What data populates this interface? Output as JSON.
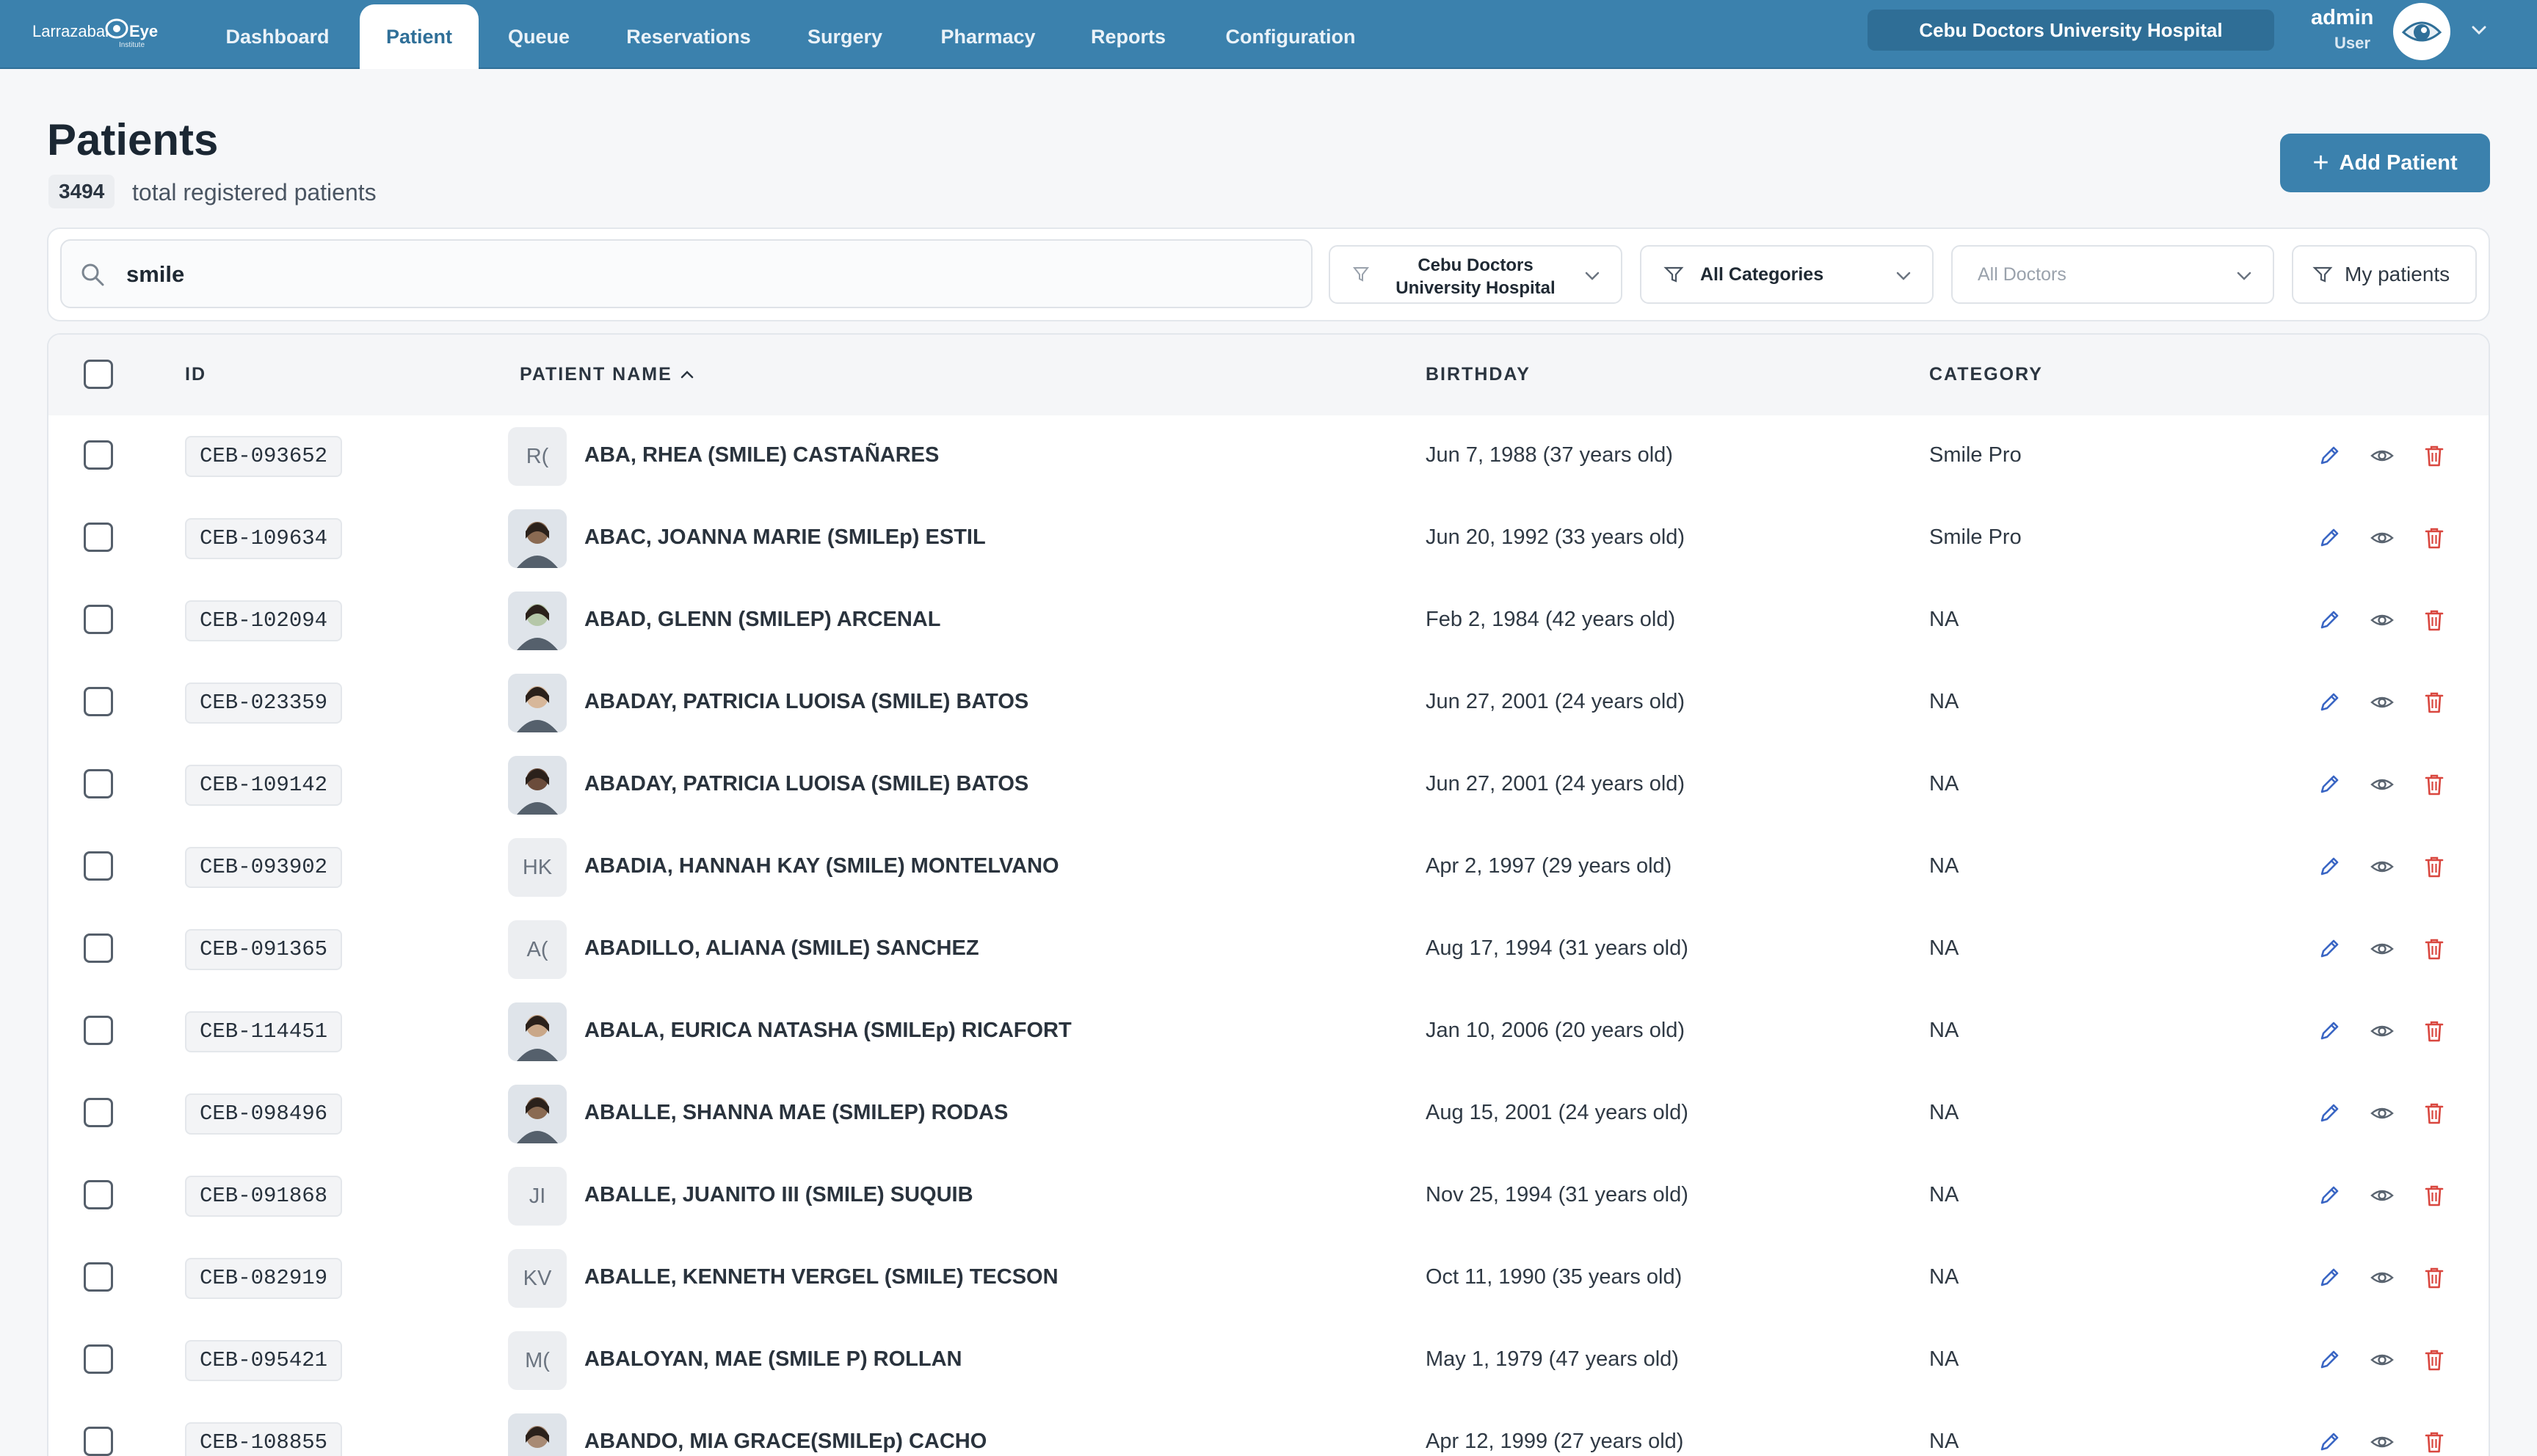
{
  "app": {
    "logo_text": "Larrazabal",
    "logo_brand": "Eye",
    "logo_sub": "Institute"
  },
  "nav": {
    "tabs": [
      {
        "label": "Dashboard",
        "active": false
      },
      {
        "label": "Patient",
        "active": true
      },
      {
        "label": "Queue",
        "active": false
      },
      {
        "label": "Reservations",
        "active": false
      },
      {
        "label": "Surgery",
        "active": false
      },
      {
        "label": "Pharmacy",
        "active": false
      },
      {
        "label": "Reports",
        "active": false
      },
      {
        "label": "Configuration",
        "active": false
      }
    ],
    "hospital": "Cebu Doctors University Hospital",
    "user": {
      "name": "admin",
      "role": "User"
    }
  },
  "page": {
    "title": "Patients",
    "total_count": "3494",
    "total_label": "total registered patients",
    "add_button": "Add Patient"
  },
  "filters": {
    "search_value": "smile",
    "hospital_line1": "Cebu Doctors",
    "hospital_line2": "University Hospital",
    "category": "All Categories",
    "doctor": "All Doctors",
    "my_patients": "My patients"
  },
  "table": {
    "columns": {
      "id": "ID",
      "name": "PATIENT NAME",
      "birthday": "BIRTHDAY",
      "category": "CATEGORY"
    },
    "rows": [
      {
        "id": "CEB-093652",
        "initials": "R(",
        "photo": false,
        "name": "ABA, RHEA (SMILE) CASTAÑARES",
        "birthday": "Jun 7, 1988 (37 years old)",
        "category": "Smile Pro"
      },
      {
        "id": "CEB-109634",
        "initials": "",
        "photo": true,
        "name": "ABAC, JOANNA MARIE (SMILEp) ESTIL",
        "birthday": "Jun 20, 1992 (33 years old)",
        "category": "Smile Pro"
      },
      {
        "id": "CEB-102094",
        "initials": "",
        "photo": true,
        "name": "ABAD, GLENN (SMILEP) ARCENAL",
        "birthday": "Feb 2, 1984 (42 years old)",
        "category": "NA"
      },
      {
        "id": "CEB-023359",
        "initials": "",
        "photo": true,
        "name": "ABADAY, PATRICIA LUOISA (SMILE) BATOS",
        "birthday": "Jun 27, 2001 (24 years old)",
        "category": "NA"
      },
      {
        "id": "CEB-109142",
        "initials": "",
        "photo": true,
        "name": "ABADAY, PATRICIA LUOISA (SMILE) BATOS",
        "birthday": "Jun 27, 2001 (24 years old)",
        "category": "NA"
      },
      {
        "id": "CEB-093902",
        "initials": "HK",
        "photo": false,
        "name": "ABADIA, HANNAH KAY (SMILE) MONTELVANO",
        "birthday": "Apr 2, 1997 (29 years old)",
        "category": "NA"
      },
      {
        "id": "CEB-091365",
        "initials": "A(",
        "photo": false,
        "name": "ABADILLO, ALIANA (SMILE) SANCHEZ",
        "birthday": "Aug 17, 1994 (31 years old)",
        "category": "NA"
      },
      {
        "id": "CEB-114451",
        "initials": "",
        "photo": true,
        "name": "ABALA, EURICA NATASHA (SMILEp) RICAFORT",
        "birthday": "Jan 10, 2006 (20 years old)",
        "category": "NA"
      },
      {
        "id": "CEB-098496",
        "initials": "",
        "photo": true,
        "name": "ABALLE, SHANNA MAE (SMILEP) RODAS",
        "birthday": "Aug 15, 2001 (24 years old)",
        "category": "NA"
      },
      {
        "id": "CEB-091868",
        "initials": "JI",
        "photo": false,
        "name": "ABALLE, JUANITO III (SMILE) SUQUIB",
        "birthday": "Nov 25, 1994 (31 years old)",
        "category": "NA"
      },
      {
        "id": "CEB-082919",
        "initials": "KV",
        "photo": false,
        "name": "ABALLE, KENNETH VERGEL (SMILE) TECSON",
        "birthday": "Oct 11, 1990 (35 years old)",
        "category": "NA"
      },
      {
        "id": "CEB-095421",
        "initials": "M(",
        "photo": false,
        "name": "ABALOYAN, MAE (SMILE P) ROLLAN",
        "birthday": "May 1, 1979 (47 years old)",
        "category": "NA"
      },
      {
        "id": "CEB-108855",
        "initials": "",
        "photo": true,
        "name": "ABANDO, MIA GRACE(SMILEp) CACHO",
        "birthday": "Apr 12, 1999 (27 years old)",
        "category": "NA"
      }
    ]
  },
  "colors": {
    "primary": "#3b81ad",
    "edit": "#3a66c4",
    "view": "#5a6470",
    "delete": "#d9473f"
  }
}
